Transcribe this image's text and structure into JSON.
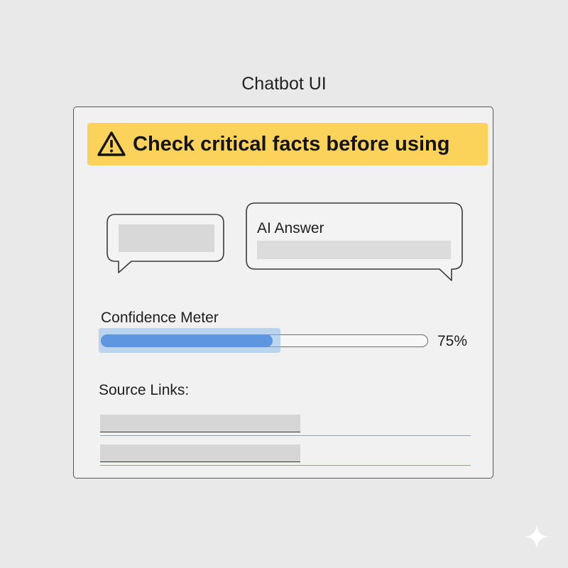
{
  "app": {
    "title": "Chatbot UI"
  },
  "warning": {
    "icon": "warning-triangle-icon",
    "text": "Check critical facts before using",
    "color": "#fbd25a"
  },
  "chat": {
    "user_message": {
      "text": ""
    },
    "ai_message": {
      "title": "AI Answer",
      "text": ""
    }
  },
  "confidence": {
    "label": "Confidence Meter",
    "value": 0.75,
    "value_text": "75%",
    "color": "#5e97df"
  },
  "sources": {
    "title": "Source Links:",
    "links": [
      {
        "text": ""
      },
      {
        "text": ""
      }
    ],
    "underline_color": "#5ccf3a"
  },
  "decor": {
    "corner_icon": "sparkle-icon"
  }
}
